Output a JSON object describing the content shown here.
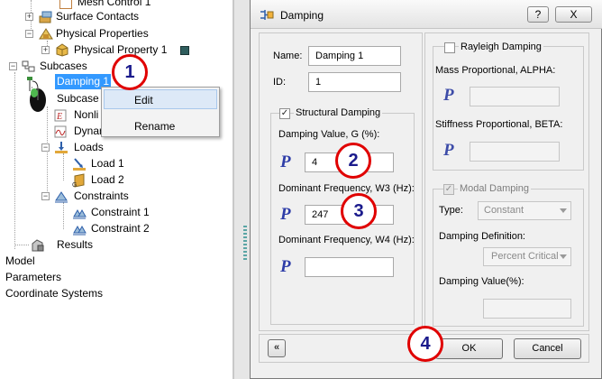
{
  "tree": {
    "items": [
      {
        "label": "Mesh Control 1"
      },
      {
        "label": "Surface Contacts"
      },
      {
        "label": "Physical Properties"
      },
      {
        "label": "Physical Property 1"
      },
      {
        "label": "Subcases"
      },
      {
        "label": "Damping 1"
      },
      {
        "label": "Subcase 1"
      },
      {
        "label": "Nonli"
      },
      {
        "label": "Dynar"
      },
      {
        "label": "Loads"
      },
      {
        "label": "Load 1"
      },
      {
        "label": "Load 2"
      },
      {
        "label": "Constraints"
      },
      {
        "label": "Constraint 1"
      },
      {
        "label": "Constraint 2"
      },
      {
        "label": "Results"
      }
    ],
    "roots": [
      "Model",
      "Parameters",
      "Coordinate Systems"
    ]
  },
  "context_menu": {
    "items": [
      "Edit",
      "Rename"
    ]
  },
  "callouts": [
    "1",
    "2",
    "3",
    "4"
  ],
  "dialog": {
    "title": "Damping",
    "help_button": "?",
    "close_button": "X",
    "name_label": "Name:",
    "name_value": "Damping 1",
    "id_label": "ID:",
    "id_value": "1",
    "structural": {
      "label": "Structural Damping",
      "checked": true,
      "damping_value_label": "Damping Value, G (%):",
      "damping_value": "4",
      "w3_label": "Dominant Frequency, W3 (Hz):",
      "w3_value": "247",
      "w4_label": "Dominant Frequency, W4 (Hz):",
      "w4_value": ""
    },
    "rayleigh": {
      "label": "Rayleigh Damping",
      "checked": false,
      "alpha_label": "Mass Proportional, ALPHA:",
      "beta_label": "Stiffness Proportional, BETA:"
    },
    "modal": {
      "label": "Modal Damping",
      "checked": true,
      "type_label": "Type:",
      "type_value": "Constant",
      "definition_label": "Damping Definition:",
      "definition_value": "Percent Critical",
      "value_label": "Damping Value(%):"
    },
    "param_symbol": "P",
    "ok_label": "OK",
    "cancel_label": "Cancel",
    "collapse_symbol": "«"
  },
  "colors": {
    "selection": "#3399ff",
    "callout_border": "#e00000",
    "callout_text": "#1a1a8c",
    "param_icon": "#2e3da8"
  }
}
